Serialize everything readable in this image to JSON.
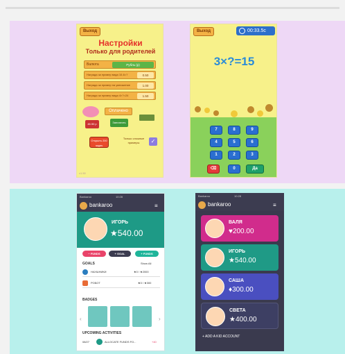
{
  "settings": {
    "exit": "Выход",
    "title": "Настройки",
    "subtitle": "Только для родителей",
    "currency_label": "Валюта",
    "currency_value": "Рубль (р)",
    "rows": [
      {
        "label": "Награда за пример вида 10-6=?",
        "value": "0.50"
      },
      {
        "label": "Награда за пример на умножение",
        "value": "1.00"
      },
      {
        "label": "Награда за пример вида 4×?=24",
        "value": "1.50"
      }
    ],
    "paid": "Оплачено",
    "balance": "46.50 р",
    "pay_button": "Заплатить",
    "unlock": "Открыть 200 задач",
    "only_hard": "Только сложные примеры",
    "version": "v1.50"
  },
  "game": {
    "exit": "Выход",
    "timer": "00:33.5c",
    "equation": "3×?=15",
    "keys": [
      "7",
      "8",
      "9",
      "4",
      "5",
      "6",
      "1",
      "2",
      "3"
    ],
    "zero": "0",
    "go": "Да"
  },
  "bankaroo_left": {
    "status_left": "Bankaroo",
    "status_time": "10:28",
    "logo": "bankaroo",
    "kid_name": "ИГОРЬ",
    "kid_balance": "★540.00",
    "funds_minus": "FUNDS",
    "goal": "GOAL",
    "funds_plus": "FUNDS",
    "goals_header": "GOALS",
    "show_all": "Show All",
    "goals": [
      {
        "name": "НАУШНИКИ",
        "amount": "★0 / ★2000"
      },
      {
        "name": "РОБОТ",
        "amount": "★0 / ★300"
      }
    ],
    "badges_header": "BADGES",
    "upcoming_header": "UPCOMING ACTIVITIES",
    "upcoming_date": "08/27",
    "upcoming_text": "ALLOCATE FUNDS FO...",
    "upcoming_amount": "+40"
  },
  "bankaroo_right": {
    "status_left": "Bankaroo",
    "status_time": "10:28",
    "logo": "bankaroo",
    "kids": [
      {
        "name": "ВАЛЯ",
        "balance": "♥200.00",
        "color": "#d12c8c"
      },
      {
        "name": "ИГОРЬ",
        "balance": "★540.00",
        "color": "#1f9a86"
      },
      {
        "name": "САША",
        "balance": "♦300.00",
        "color": "#4a4fc0"
      },
      {
        "name": "СВЕТА",
        "balance": "★400.00",
        "color": "#3d3f63"
      }
    ],
    "add_kid": "ADD A KID ACCOUNT"
  }
}
